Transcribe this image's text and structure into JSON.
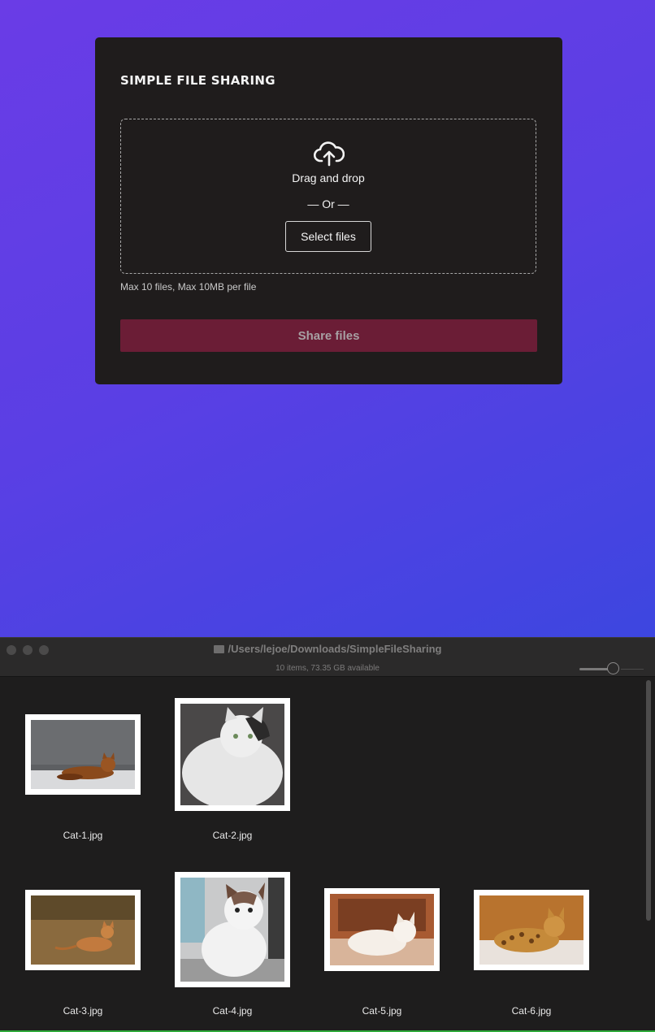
{
  "upload_card": {
    "title": "SIMPLE FILE SHARING",
    "upload_icon": "cloud-upload-icon",
    "drag_drop_text": "Drag and drop",
    "or_text": "— Or —",
    "select_files_label": "Select files",
    "limits_text": "Max 10 files, Max 10MB per file",
    "share_button_label": "Share files",
    "share_button_color": "#6b1d36"
  },
  "finder": {
    "path": "/Users/lejoe/Downloads/SimpleFileSharing",
    "folder_icon": "folder-icon",
    "status": "10 items, 73.35 GB available",
    "files": [
      {
        "name": "Cat-1.jpg"
      },
      {
        "name": "Cat-2.jpg"
      },
      {
        "name": "Cat-3.jpg"
      },
      {
        "name": "Cat-4.jpg"
      },
      {
        "name": "Cat-5.jpg"
      },
      {
        "name": "Cat-6.jpg"
      }
    ]
  },
  "colors": {
    "background_gradient_start": "#6a3ce6",
    "background_gradient_end": "#2f4ee0",
    "card_background": "#1f1c1c",
    "finder_background": "#1e1d1d"
  }
}
